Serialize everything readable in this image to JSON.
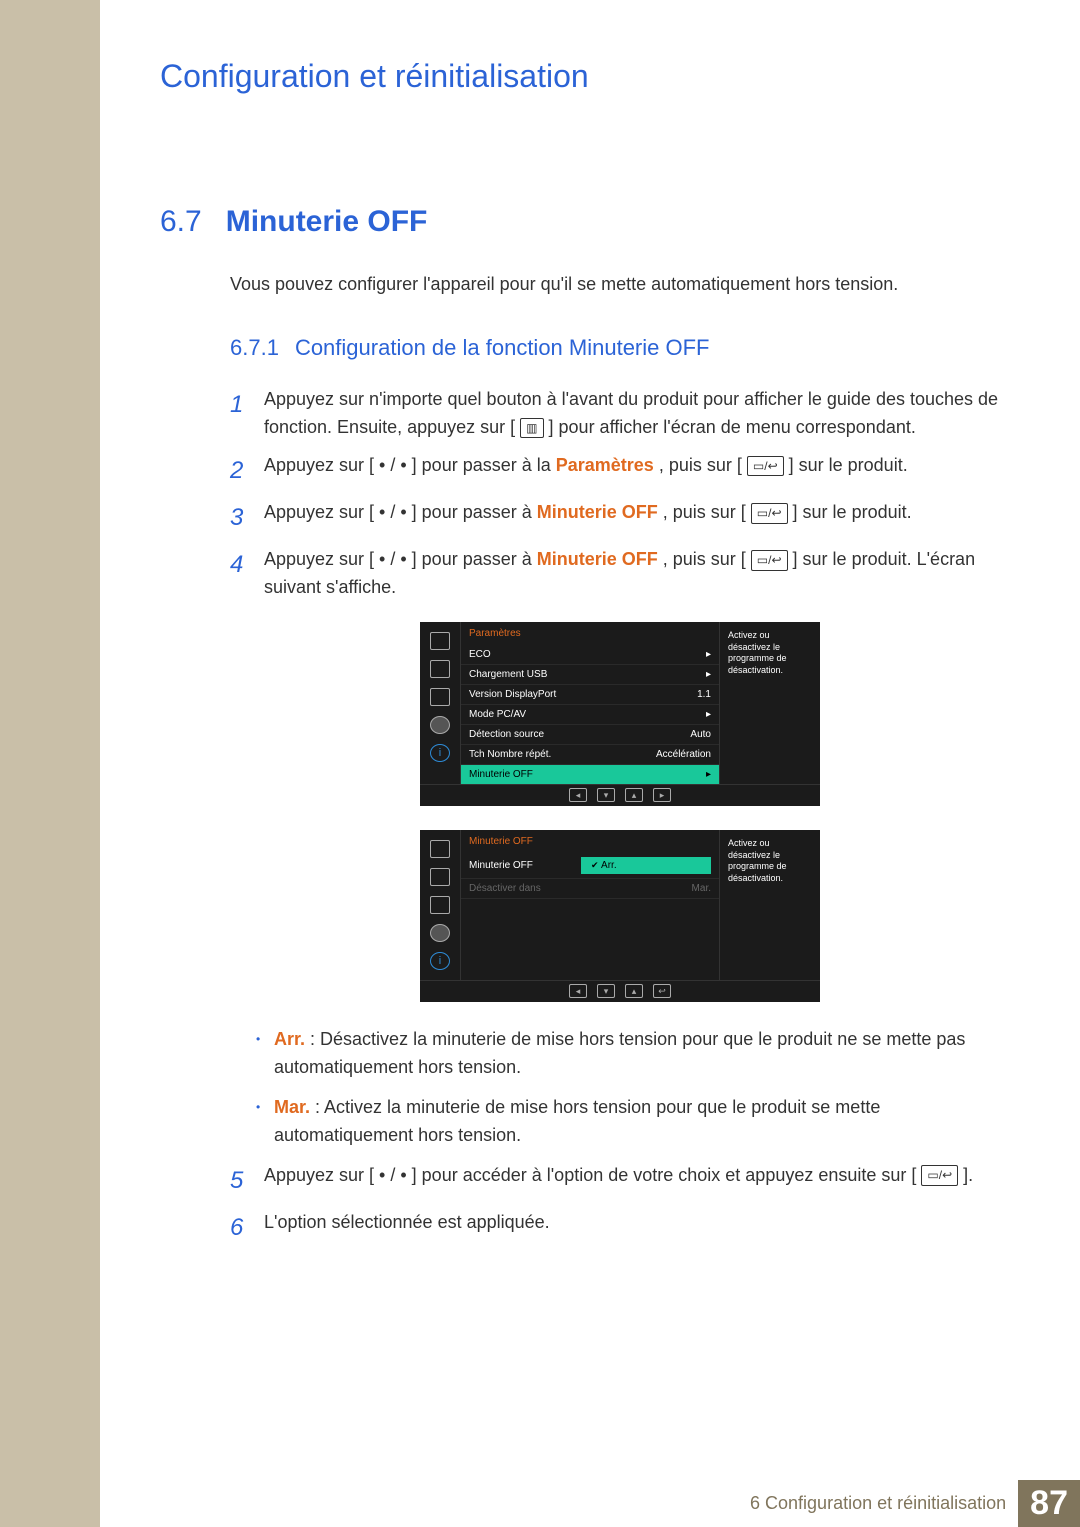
{
  "chapter_title": "Configuration et réinitialisation",
  "section": {
    "num": "6.7",
    "title": "Minuterie OFF"
  },
  "intro": "Vous pouvez configurer l'appareil pour qu'il se mette automatiquement hors tension.",
  "subsection": {
    "num": "6.7.1",
    "title": "Configuration de la fonction Minuterie OFF"
  },
  "steps": {
    "s1": "Appuyez sur n'importe quel bouton à l'avant du produit pour afficher le guide des touches de fonction. Ensuite, appuyez sur [",
    "s1b": "] pour afficher l'écran de menu correspondant.",
    "s2a": "Appuyez sur [ • / • ] pour passer à la ",
    "s2b": "Paramètres",
    "s2c": ", puis sur [",
    "s2d": "] sur le produit.",
    "s3a": "Appuyez sur [ • / • ] pour passer à ",
    "s3b": "Minuterie OFF",
    "s3c": ", puis sur [",
    "s3d": "] sur le produit.",
    "s4a": "Appuyez sur [ • / • ] pour passer à ",
    "s4b": "Minuterie OFF",
    "s4c": ", puis sur [",
    "s4d": "] sur le produit. L'écran suivant s'affiche.",
    "s5": "Appuyez sur [ • / • ] pour accéder à l'option de votre choix et appuyez ensuite sur [",
    "s5b": "].",
    "s6": "L'option sélectionnée est appliquée."
  },
  "bullets": {
    "arr_label": "Arr.",
    "arr_text": " : Désactivez la minuterie de mise hors tension pour que le produit ne se mette pas automatiquement hors tension.",
    "mar_label": "Mar.",
    "mar_text": " : Activez la minuterie de mise hors tension pour que le produit se mette automatiquement hors tension."
  },
  "osd1": {
    "header": "Paramètres",
    "rows": [
      {
        "label": "ECO",
        "value": "▸"
      },
      {
        "label": "Chargement USB",
        "value": "▸"
      },
      {
        "label": "Version DisplayPort",
        "value": "1.1"
      },
      {
        "label": "Mode PC/AV",
        "value": "▸"
      },
      {
        "label": "Détection source",
        "value": "Auto"
      },
      {
        "label": "Tch Nombre répét.",
        "value": "Accélération"
      }
    ],
    "selected": {
      "label": "Minuterie OFF",
      "value": "▸"
    },
    "help": "Activez ou désactivez le programme de désactivation."
  },
  "osd2": {
    "header": "Minuterie OFF",
    "row1": {
      "label": "Minuterie OFF"
    },
    "sel": "Arr.",
    "row2": {
      "label": "Désactiver dans",
      "value": "Mar."
    },
    "help": "Activez ou désactivez le programme de désactivation."
  },
  "footer": {
    "chapter": "6 Configuration et réinitialisation",
    "page": "87"
  }
}
